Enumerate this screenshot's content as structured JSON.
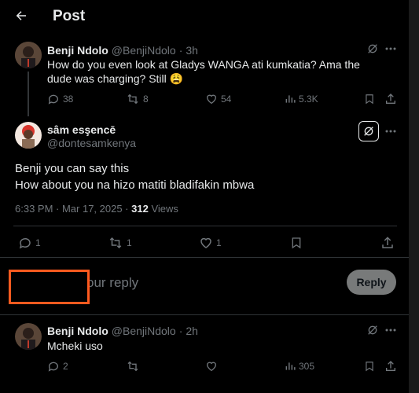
{
  "header": {
    "title": "Post"
  },
  "parent_post": {
    "name": "Benji Ndolo",
    "handle": "@BenjiNdolo",
    "sep": "·",
    "time": "3h",
    "text": "How do you even look at Gladys WANGA ati kumkatia? Ama the dude was charging? Still 😩",
    "replies": "38",
    "reposts": "8",
    "likes": "54",
    "views": "5.3K"
  },
  "main_post": {
    "name": "sâm esşencē",
    "handle": "@dontesamkenya",
    "line1": "Benji you can say this",
    "line2": "How about you na hizo matiti bladifakin mbwa",
    "timestamp": "6:33 PM · Mar 17, 2025 · ",
    "views_count": "312",
    "views_label": " Views",
    "replies": "1",
    "reposts": "1",
    "likes": "1"
  },
  "composer": {
    "placeholder_visible": "our reply",
    "reply_button": "Reply"
  },
  "reply_post": {
    "name": "Benji Ndolo",
    "handle": "@BenjiNdolo",
    "sep": "·",
    "time": "2h",
    "text": "Mcheki uso",
    "replies": "2",
    "views": "305"
  },
  "colors": {
    "background": "#000000",
    "text": "#e7e9ea",
    "muted": "#71767b",
    "divider": "#2f3336",
    "highlight_box": "#ff5a1f"
  }
}
